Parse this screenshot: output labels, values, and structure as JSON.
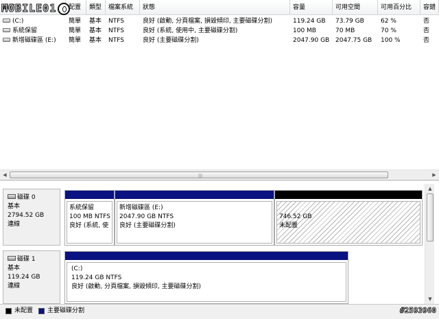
{
  "watermark": {
    "brand": "MOBILE01"
  },
  "table": {
    "headers": [
      "磁碟區",
      "配置",
      "類型",
      "檔案系統",
      "狀態",
      "容量",
      "可用空間",
      "可用百分比",
      "容錯"
    ],
    "rows": [
      {
        "volume": "(C:)",
        "layout": "簡單",
        "type": "基本",
        "fs": "NTFS",
        "status": "良好 (啟動, 分頁檔案, 損毀傾印, 主要磁碟分割)",
        "capacity": "119.24 GB",
        "free": "73.79 GB",
        "percent": "62 %",
        "fault": "否"
      },
      {
        "volume": "系統保留",
        "layout": "簡單",
        "type": "基本",
        "fs": "NTFS",
        "status": "良好 (系統, 使用中, 主要磁碟分割)",
        "capacity": "100 MB",
        "free": "70 MB",
        "percent": "70 %",
        "fault": "否"
      },
      {
        "volume": "新增磁碟區 (E:)",
        "layout": "簡單",
        "type": "基本",
        "fs": "NTFS",
        "status": "良好 (主要磁碟分割)",
        "capacity": "2047.90 GB",
        "free": "2047.75 GB",
        "percent": "100 %",
        "fault": "否"
      }
    ]
  },
  "disks": [
    {
      "name": "磁碟 0",
      "kind": "基本",
      "size": "2794.52 GB",
      "state": "連線",
      "partitions": [
        {
          "name": "系統保留",
          "size": "100 MB NTFS",
          "status": "良好 (系統, 使"
        },
        {
          "name": "新增磁碟區  (E:)",
          "size": "2047.90 GB NTFS",
          "status": "良好 (主要磁碟分割)"
        },
        {
          "size": "746.52 GB",
          "status": "未配置"
        }
      ]
    },
    {
      "name": "磁碟 1",
      "kind": "基本",
      "size": "119.24 GB",
      "state": "連線",
      "partitions": [
        {
          "name": "(C:)",
          "size": "119.24 GB NTFS",
          "status": "良好 (啟動, 分頁檔案, 損毀傾印, 主要磁碟分割)"
        }
      ]
    }
  ],
  "legend": {
    "items": [
      {
        "label": "未配置",
        "color": "#000000"
      },
      {
        "label": "主要磁碟分割",
        "color": "#0a1180"
      }
    ]
  },
  "stamp": "#2593960",
  "icons": {
    "volume": "drive-icon",
    "disk": "disk-icon"
  },
  "colors": {
    "primary_partition": "#0a1180",
    "unallocated": "#000000"
  }
}
